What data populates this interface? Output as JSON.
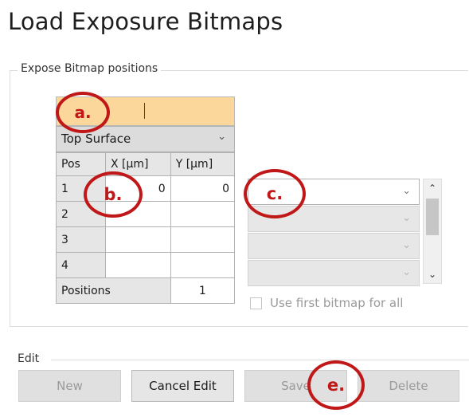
{
  "page": {
    "title": "Load Exposure Bitmaps"
  },
  "expose_group": {
    "label": "Expose Bitmap positions",
    "name_field_value": "",
    "surface_select": "Top Surface",
    "table": {
      "headers": [
        "Pos",
        "X [µm]",
        "Y [µm]"
      ],
      "rows": [
        {
          "pos": "1",
          "x": "0",
          "y": "0"
        },
        {
          "pos": "2",
          "x": "",
          "y": ""
        },
        {
          "pos": "3",
          "x": "",
          "y": ""
        },
        {
          "pos": "4",
          "x": "",
          "y": ""
        }
      ],
      "footer_label": "Positions",
      "footer_value": "1"
    },
    "bitmap_selects": [
      "",
      "",
      "",
      ""
    ],
    "use_first_label": "Use first bitmap for all",
    "use_first_checked": false
  },
  "edit_group": {
    "label": "Edit",
    "buttons": {
      "new": "New",
      "cancel": "Cancel Edit",
      "save": "Save",
      "delete": "Delete"
    }
  },
  "annotations": {
    "a": "a.",
    "b": "b.",
    "c": "c.",
    "e": "e."
  },
  "colors": {
    "highlight": "#fbd79b",
    "annotation": "#c01818"
  },
  "icons": {
    "dropdown": "chevron-down-icon",
    "scroll_up": "chevron-up-icon",
    "scroll_down": "chevron-down-icon"
  }
}
